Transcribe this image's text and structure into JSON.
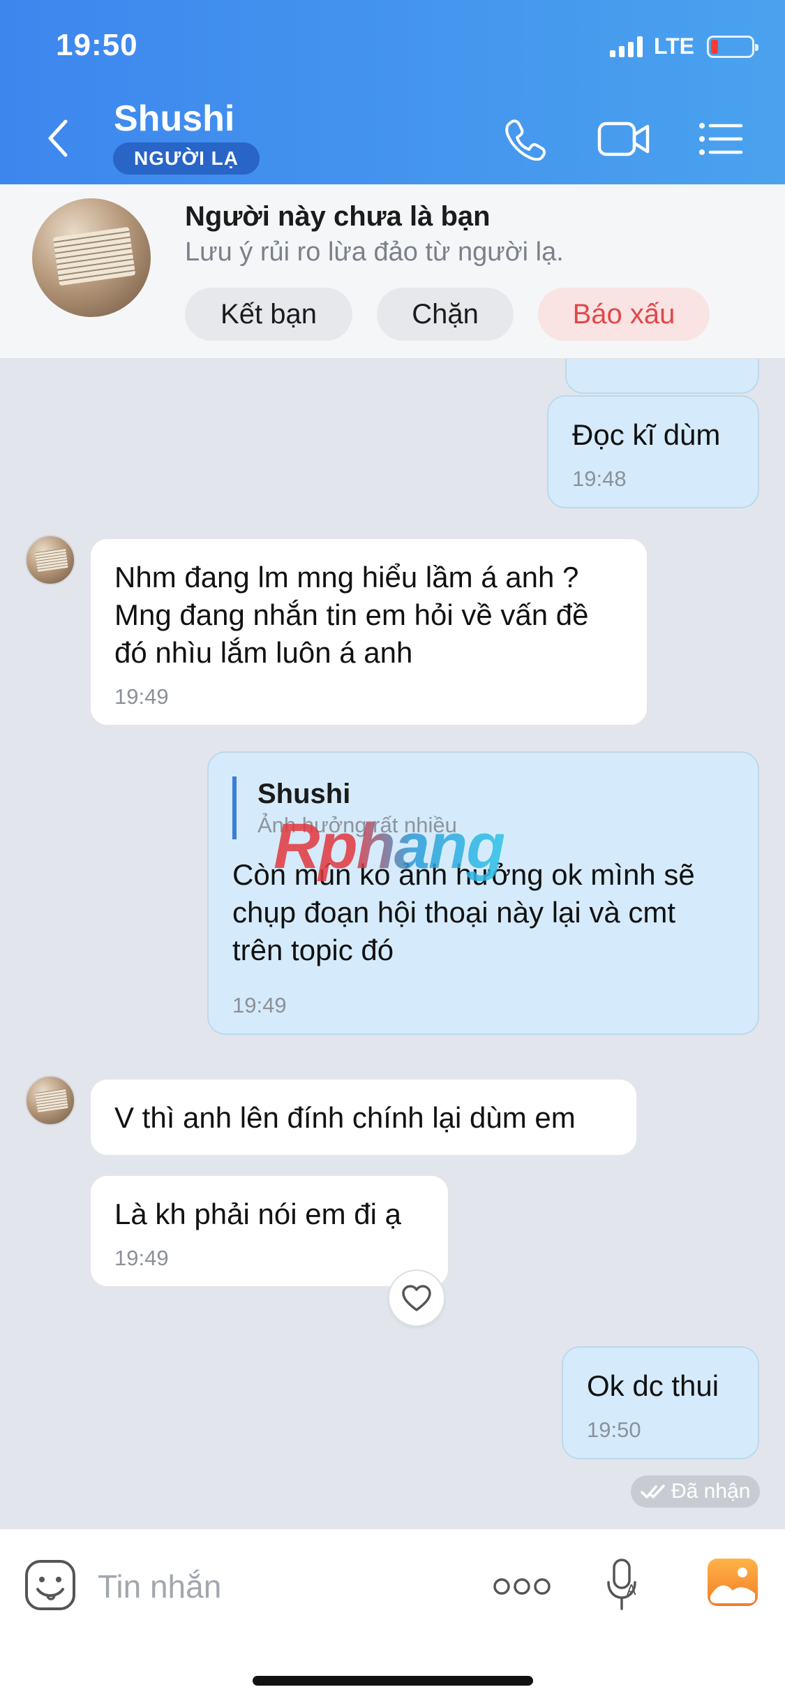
{
  "status_bar": {
    "time": "19:50",
    "network": "LTE"
  },
  "header": {
    "contact_name": "Shushi",
    "badge": "NGƯỜI LẠ"
  },
  "stranger_panel": {
    "title": "Người này chưa là bạn",
    "subtitle": "Lưu ý rủi ro lừa đảo từ người lạ.",
    "add_friend": "Kết bạn",
    "block": "Chặn",
    "report": "Báo xấu"
  },
  "messages": [
    {
      "direction": "out",
      "text": "Đọc kĩ dùm",
      "time": "19:48"
    },
    {
      "direction": "in",
      "text": "Nhm đang lm mng hiểu lầm á anh ? Mng đang nhắn tin em hỏi về vấn đề đó nhìu lắm luôn á anh",
      "time": "19:49"
    },
    {
      "direction": "out",
      "quote_name": "Shushi",
      "quote_text": "Ảnh hưởng rất nhiều",
      "text": "Còn mún ko ảnh hưởng ok mình sẽ chụp đoạn hội thoại này lại và cmt trên topic đó",
      "time": "19:49"
    },
    {
      "direction": "in",
      "text": "V thì anh lên đính chính lại dùm em"
    },
    {
      "direction": "in",
      "text": "Là kh phải nói em đi ạ",
      "time": "19:49"
    },
    {
      "direction": "out",
      "text": "Ok dc thui",
      "time": "19:50"
    }
  ],
  "delivery_status": "Đã nhận",
  "watermark": "Rphang",
  "composer": {
    "placeholder": "Tin nhắn"
  },
  "colors": {
    "header_start": "#3d86ee",
    "header_end": "#4aa2ee",
    "outgoing_bubble": "#d5ebfb",
    "report_text": "#e0484b"
  },
  "icons": [
    "back-arrow-icon",
    "phone-icon",
    "video-camera-icon",
    "list-menu-icon",
    "heart-icon",
    "emoji-icon",
    "more-dots-icon",
    "mic-translate-icon",
    "photo-gallery-icon",
    "double-check-icon"
  ]
}
